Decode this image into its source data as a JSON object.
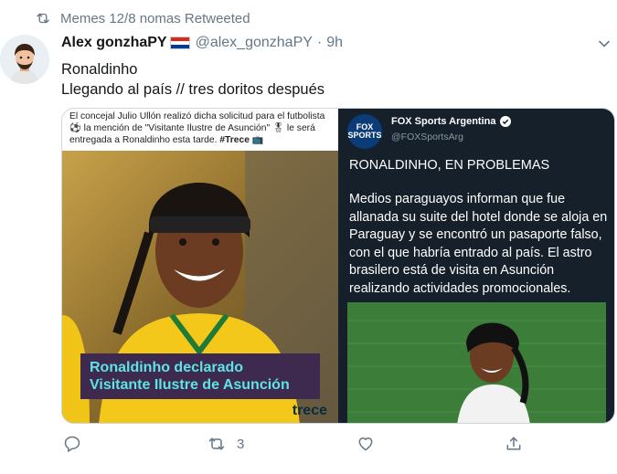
{
  "retweet": {
    "text": "Memes 12/8 nomas Retweeted"
  },
  "tweet": {
    "display_name": "Alex gonzhaPY",
    "handle": "@alex_gonzhaPY",
    "separator": "·",
    "time": "9h",
    "text_line1": "Ronaldinho",
    "text_line2": "Llegando al país // tres doritos después"
  },
  "media_left": {
    "caption_text": "El concejal Julio Ullón realizó dicha solicitud para el futbolista ⚽ la mención de \"Visitante Ilustre de Asunción\" 🎖 le será entregada a Ronaldinho esta tarde. ",
    "caption_tag": "#Trece 📺",
    "badge_line1": "Ronaldinho declarado",
    "badge_line2": "Visitante Ilustre de Asunción",
    "brand": "trece"
  },
  "media_right": {
    "logo_text": "FOX SPORTS",
    "account_name": "FOX Sports Argentina",
    "account_handle": "@FOXSportsArg",
    "headline": "RONALDINHO, EN PROBLEMAS",
    "body": "Medios paraguayos informan que fue allanada su suite del hotel donde se aloja en Paraguay y se encontró un pasaporte falso, con el que habría entrado al país. El astro brasilero está de visita en Asunción realizando actividades promocionales."
  },
  "actions": {
    "reply_count": "",
    "retweet_count": "3",
    "like_count": "",
    "share_count": ""
  },
  "colors": {
    "muted": "#657786",
    "border": "#ccd6dd",
    "dark_card": "#15202b",
    "badge_bg": "#3f2a4f",
    "badge_text": "#5ee4e4",
    "grass": "#3d7d3a"
  }
}
